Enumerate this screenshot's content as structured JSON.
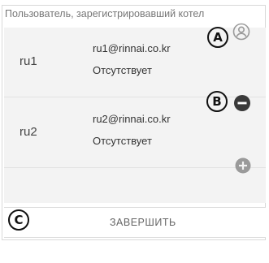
{
  "header": {
    "label": "Пользователь, зарегистрировавший котел"
  },
  "users": [
    {
      "name": "ru1",
      "email": "ru1@rinnai.co.kr",
      "status": "Отсутствует",
      "action_icon": "user-outline-icon"
    },
    {
      "name": "ru2",
      "email": "ru2@rinnai.co.kr",
      "status": "Отсутствует",
      "action_icon": "remove-circle-icon"
    }
  ],
  "add_button": {
    "icon": "add-circle-icon"
  },
  "footer": {
    "finish_label": "ЗАВЕРШИТЬ"
  },
  "callouts": {
    "a": "A",
    "b": "B",
    "c": "C"
  },
  "colors": {
    "list_background": "#f3f3f3",
    "icon_dark": "#3a3a3a",
    "icon_light": "#9a9a9a"
  }
}
